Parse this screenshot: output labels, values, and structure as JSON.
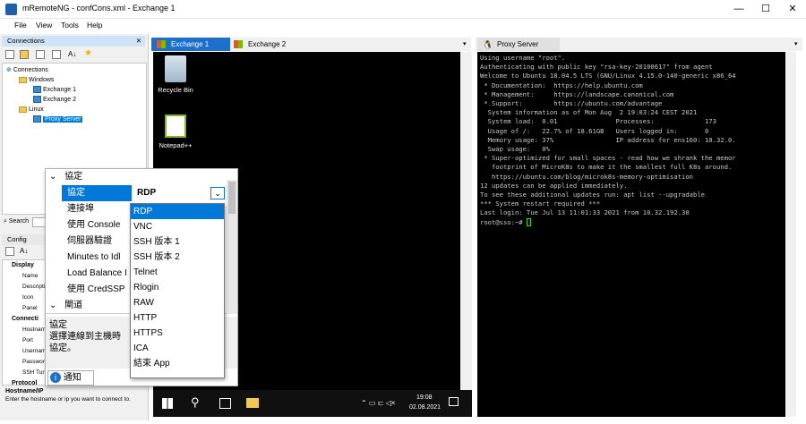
{
  "window": {
    "title": "mRemoteNG - confCons.xml - Exchange 1",
    "minimize": "—",
    "maximize": "☐",
    "close": "✕"
  },
  "menu": [
    "File",
    "View",
    "Tools",
    "Help"
  ],
  "connections_panel": {
    "title": "Connections",
    "tree": [
      {
        "label": "Connections",
        "level": 0,
        "kind": "root"
      },
      {
        "label": "Windows",
        "level": 1,
        "kind": "folder"
      },
      {
        "label": "Exchange 1",
        "level": 2,
        "kind": "connection"
      },
      {
        "label": "Exchange 2",
        "level": 2,
        "kind": "connection"
      },
      {
        "label": "Linux",
        "level": 1,
        "kind": "folder"
      },
      {
        "label": "Proxy Server",
        "level": 2,
        "kind": "connection",
        "selected": true
      }
    ],
    "search_label": "Search"
  },
  "config_panel": {
    "title": "Config",
    "categories": [
      {
        "name": "Display",
        "rows": [
          "Name",
          "Descripti",
          "Icon",
          "Panel"
        ]
      },
      {
        "name": "Connecti",
        "rows": [
          "Hostnam",
          "Port",
          "Usernam",
          "Passwor",
          "SSH Tunn"
        ]
      },
      {
        "name": "Protocol",
        "rows": []
      }
    ],
    "help_title": "Hostname/IP",
    "help_text": "Enter the hostname or ip you want to connect to."
  },
  "tabs": {
    "left": [
      {
        "label": "Exchange 1",
        "active": true
      },
      {
        "label": "Exchange 2",
        "active": false
      }
    ],
    "right": [
      {
        "label": "Proxy Server",
        "active": true
      }
    ]
  },
  "desktop": {
    "icons": [
      "Recycle Bin",
      "Notepad++"
    ],
    "clock_time": "19:08",
    "clock_date": "02.08.2021"
  },
  "protocol_popup": {
    "category": "協定",
    "rows": [
      {
        "label": "協定",
        "value": "RDP",
        "selected": true
      },
      {
        "label": "連接埠"
      },
      {
        "label": "使用 Console"
      },
      {
        "label": "伺服器驗證"
      },
      {
        "label": "Minutes to Idl"
      },
      {
        "label": "Load Balance I"
      },
      {
        "label": "使用 CredSSP"
      }
    ],
    "next_category": "閘道",
    "desc_title": "協定",
    "desc_text": "選擇連線到主機時",
    "desc_text2": "協定。",
    "notify_tab": "通知",
    "options": [
      "RDP",
      "VNC",
      "SSH 版本 1",
      "SSH 版本 2",
      "Telnet",
      "Rlogin",
      "RAW",
      "HTTP",
      "HTTPS",
      "ICA",
      "結束 App"
    ]
  },
  "terminal": {
    "lines": [
      "Using username \"root\".",
      "Authenticating with public key \"rsa-key-20100617\" from agent",
      "Welcome to Ubuntu 18.04.5 LTS (GNU/Linux 4.15.0-140-generic x86_64",
      "",
      " * Documentation:  https://help.ubuntu.com",
      " * Management:     https://landscape.canonical.com",
      " * Support:        https://ubuntu.com/advantage",
      "",
      "  System information as of Mon Aug  2 19:03:24 CEST 2021",
      "",
      "  System load:  0.01               Processes:             173",
      "  Usage of /:   22.7% of 18.61GB   Users logged in:       0",
      "  Memory usage: 37%                IP address for ens160: 10.32.0.",
      "  Swap usage:   0%",
      "",
      " * Super-optimized for small spaces - read how we shrank the memor",
      "   footprint of MicroK8s to make it the smallest full K8s around.",
      "",
      "   https://ubuntu.com/blog/microk8s-memory-optimisation",
      "",
      "12 updates can be applied immediately.",
      "To see these additional updates run: apt list --upgradable",
      "",
      "",
      "*** System restart required ***",
      "Last login: Tue Jul 13 11:01:33 2021 from 10.32.192.30",
      "root@sso:~# "
    ]
  },
  "colors": {
    "accent": "#1d6fc9",
    "selection": "#0078d7",
    "terminal_bg": "#000000",
    "cursor": "#3bd83b"
  }
}
